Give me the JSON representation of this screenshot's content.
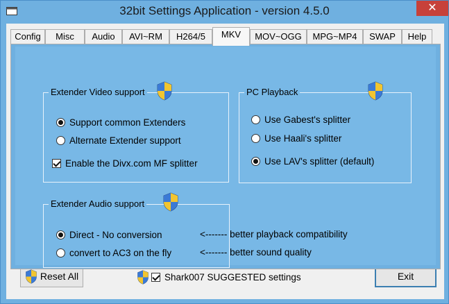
{
  "window": {
    "title": "32bit Settings Application - version 4.5.0",
    "close_glyph": "✕"
  },
  "tabs": [
    {
      "label": "Config"
    },
    {
      "label": "Misc"
    },
    {
      "label": "Audio"
    },
    {
      "label": "AVI~RM"
    },
    {
      "label": "H264/5"
    },
    {
      "label": "MKV",
      "active": true
    },
    {
      "label": "MOV~OGG"
    },
    {
      "label": "MPG~MP4"
    },
    {
      "label": "SWAP"
    },
    {
      "label": "Help"
    }
  ],
  "video_group": {
    "title": "Extender Video support",
    "icon": "uac-shield-icon",
    "options": [
      {
        "label": "Support common Extenders",
        "selected": true
      },
      {
        "label": "Alternate Extender support",
        "selected": false
      }
    ],
    "divx_checkbox": {
      "label": "Enable the Divx.com MF splitter",
      "checked": true
    }
  },
  "playback_group": {
    "title": "PC Playback",
    "icon": "uac-shield-icon",
    "options": [
      {
        "label": "Use Gabest's splitter",
        "selected": false
      },
      {
        "label": "Use Haali's splitter",
        "selected": false
      },
      {
        "label": "Use LAV's splitter (default)",
        "selected": true
      }
    ]
  },
  "audio_group": {
    "title": "Extender Audio support",
    "icon": "uac-shield-icon",
    "options": [
      {
        "label": "Direct - No conversion",
        "selected": true,
        "note": "<-------  better playback compatibility"
      },
      {
        "label": "convert to AC3 on the fly",
        "selected": false,
        "note": "<-------  better sound quality"
      }
    ]
  },
  "footer": {
    "reset_label": "Reset All",
    "suggested_label": "Shark007 SUGGESTED settings",
    "suggested_checked": true,
    "exit_label": "Exit"
  },
  "colors": {
    "window_frame": "#6fb0e0",
    "panel": "#78b8e6",
    "close_button": "#c7413a"
  }
}
